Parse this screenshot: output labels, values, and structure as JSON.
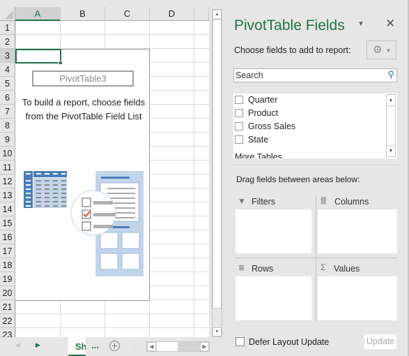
{
  "sheet": {
    "columns": [
      "A",
      "B",
      "C",
      "D"
    ],
    "rows": [
      "1",
      "2",
      "3",
      "4",
      "5",
      "6",
      "7",
      "8",
      "9",
      "10",
      "11",
      "12",
      "13",
      "14",
      "15",
      "16",
      "17",
      "18",
      "19",
      "20",
      "21",
      "22",
      "23"
    ],
    "selected_cell": "A3",
    "pivot_placeholder": {
      "name": "PivotTable3",
      "help": "To build a report, choose fields from the PivotTable Field List"
    },
    "sheet_tab": "Sh",
    "more_tabs": "...",
    "add_sheet_icon": "plus-circle-icon"
  },
  "panel": {
    "title": "PivotTable Fields",
    "choose_label": "Choose fields to add to report:",
    "search_placeholder": "Search",
    "fields": [
      {
        "label": "Quarter",
        "checked": false
      },
      {
        "label": "Product",
        "checked": false
      },
      {
        "label": "Gross Sales",
        "checked": false
      },
      {
        "label": "State",
        "checked": false
      }
    ],
    "more_tables": "More Tables...",
    "drag_label": "Drag fields between areas below:",
    "areas": {
      "filters": "Filters",
      "columns": "Columns",
      "rows": "Rows",
      "values": "Values"
    },
    "defer_label": "Defer Layout Update",
    "update_label": "Update"
  },
  "colors": {
    "accent": "#217346",
    "illustration": "#4a7ebb",
    "check": "#d9552b"
  }
}
